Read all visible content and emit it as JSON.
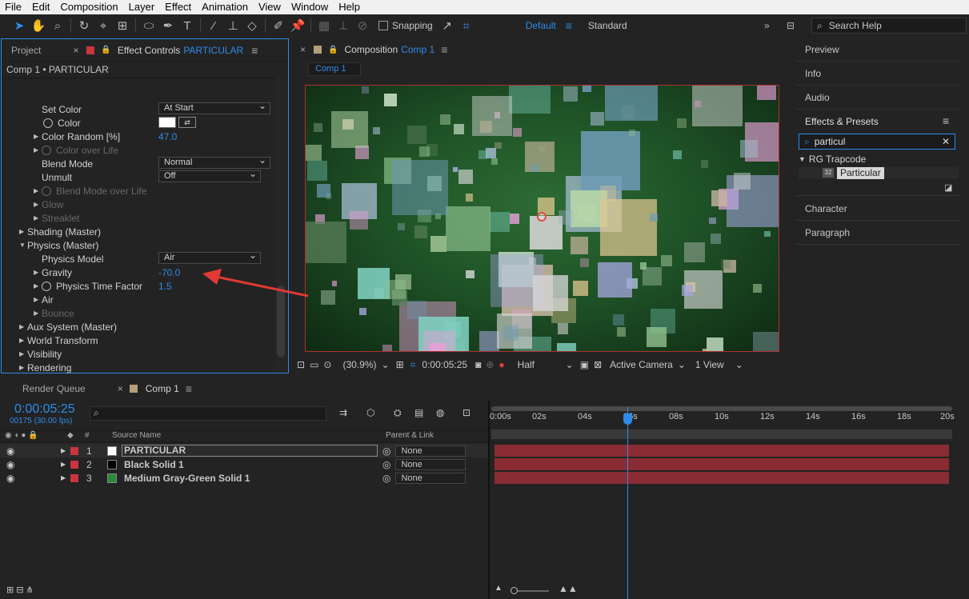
{
  "menu": [
    "File",
    "Edit",
    "Composition",
    "Layer",
    "Effect",
    "Animation",
    "View",
    "Window",
    "Help"
  ],
  "toolbar": {
    "snapping_label": "Snapping",
    "workspaces": [
      "Default",
      "Standard"
    ],
    "search_help_placeholder": "Search Help"
  },
  "left_panel": {
    "tab_project": "Project",
    "tab_effect_controls": "Effect Controls",
    "effect_layer": "PARTICULAR",
    "breadcrumb": "Comp 1 • PARTICULAR",
    "rows": {
      "set_color": "Set Color",
      "set_color_value": "At Start",
      "color": "Color",
      "color_random": "Color Random [%]",
      "color_random_value": "47.0",
      "color_over_life": "Color over Life",
      "blend_mode": "Blend Mode",
      "blend_mode_value": "Normal",
      "unmult": "Unmult",
      "unmult_value": "Off",
      "blend_mode_over_life": "Blend Mode over Life",
      "glow": "Glow",
      "streaklet": "Streaklet",
      "shading": "Shading (Master)",
      "physics": "Physics (Master)",
      "physics_model": "Physics Model",
      "physics_model_value": "Air",
      "gravity": "Gravity",
      "gravity_value": "-70.0",
      "physics_time_factor": "Physics Time Factor",
      "physics_time_factor_value": "1.5",
      "air": "Air",
      "bounce": "Bounce",
      "aux_system": "Aux System (Master)",
      "world_transform": "World Transform",
      "visibility": "Visibility",
      "rendering": "Rendering"
    }
  },
  "comp_panel": {
    "tab_label": "Composition",
    "comp_name": "Comp 1",
    "sub_tab": "Comp 1",
    "zoom": "(30.9%)",
    "timecode": "0:00:05:25",
    "resolution": "Half",
    "camera": "Active Camera",
    "view": "1 View"
  },
  "right_panel": {
    "preview": "Preview",
    "info": "Info",
    "audio": "Audio",
    "effects_presets": "Effects & Presets",
    "search_value": "particul",
    "category": "RG Trapcode",
    "effect": "Particular",
    "character": "Character",
    "paragraph": "Paragraph"
  },
  "timeline": {
    "tab_render_queue": "Render Queue",
    "tab_comp": "Comp 1",
    "timecode": "0:00:05:25",
    "frames": "00175 (30.00 fps)",
    "col_num": "#",
    "col_source": "Source Name",
    "col_parent": "Parent & Link",
    "ruler": [
      "0:00s",
      "02s",
      "04s",
      "06s",
      "08s",
      "10s",
      "12s",
      "14s",
      "16s",
      "18s",
      "20s"
    ],
    "layers": [
      {
        "num": "1",
        "name": "PARTICULAR",
        "parent": "None",
        "swatch": "#ffffff"
      },
      {
        "num": "2",
        "name": "Black Solid 1",
        "parent": "None",
        "swatch": "#000000"
      },
      {
        "num": "3",
        "name": "Medium Gray-Green Solid 1",
        "parent": "None",
        "swatch": "#2a8a3a"
      }
    ]
  },
  "colors": {
    "accent": "#2d8ceb",
    "label_red": "#c8353d",
    "layer_bar": "#8a2c33",
    "annotation_arrow": "#e03a33"
  }
}
